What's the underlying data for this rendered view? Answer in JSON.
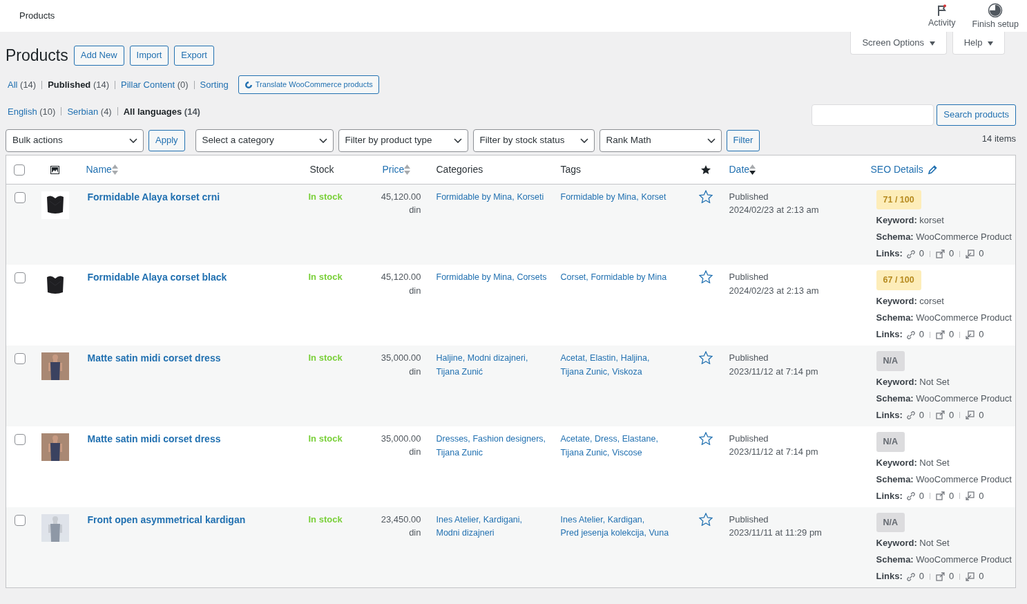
{
  "top_bar": {
    "title": "Products",
    "actions": [
      {
        "kind": "activity",
        "label": "Activity"
      },
      {
        "kind": "setup",
        "label": "Finish setup"
      }
    ]
  },
  "screen_tabs": [
    "Screen Options",
    "Help"
  ],
  "heading": {
    "title": "Products",
    "buttons": [
      "Add New",
      "Import",
      "Export"
    ]
  },
  "views": [
    {
      "label": "All",
      "count": "(14)",
      "selected": false
    },
    {
      "label": "Published",
      "count": "(14)",
      "selected": true
    },
    {
      "label": "Pillar Content",
      "count": "(0)",
      "selected": false
    },
    {
      "label": "Sorting",
      "selected": false
    }
  ],
  "translate_button": "Translate WooCommerce products",
  "languages": [
    {
      "label": "English",
      "count": "(10)",
      "selected": false
    },
    {
      "label": "Serbian",
      "count": "(4)",
      "selected": false
    },
    {
      "label": "All languages",
      "count": "(14)",
      "selected": true
    }
  ],
  "search": {
    "button": "Search products"
  },
  "filters": {
    "bulk": "Bulk actions",
    "apply": "Apply",
    "selects": [
      "Select a category",
      "Filter by product type",
      "Filter by stock status",
      "Rank Math"
    ],
    "filter": "Filter",
    "count": "14 items"
  },
  "columns": [
    {
      "kind": "check",
      "checked": false
    },
    {
      "kind": "thumb"
    },
    {
      "kind": "text",
      "label": "Name",
      "sortable": true,
      "sorted": false
    },
    {
      "kind": "text",
      "label": "Stock"
    },
    {
      "kind": "text",
      "label": "Price",
      "sortable": true,
      "sorted": false
    },
    {
      "kind": "text",
      "label": "Categories"
    },
    {
      "kind": "text",
      "label": "Tags"
    },
    {
      "kind": "featured"
    },
    {
      "kind": "text",
      "label": "Date",
      "sortable": true,
      "sorted": true
    },
    {
      "kind": "edit",
      "label": "SEO Details"
    }
  ],
  "rows": [
    {
      "checked": false,
      "image": {
        "kind": "picture"
      },
      "name": "Formidable Alaya korset crni",
      "stock": "In stock",
      "price": "45,120.00 din",
      "categories": [
        "Formidable by Mina,",
        "Korseti"
      ],
      "tags": [
        "Formidable by Mina,",
        "Korset"
      ],
      "featured": false,
      "status": "Published",
      "date": "2024/02/23 at 2:13 am",
      "seo": {
        "score": "71 / 100",
        "rated": true,
        "keyword": "**Keyword:** korset",
        "schema": "**Schema:** WooCommerce Product",
        "links_label": "Links:",
        "links": [
          "0",
          "0",
          "0"
        ]
      }
    },
    {
      "checked": false,
      "image": {
        "kind": "picture"
      },
      "name": "Formidable Alaya corset black",
      "stock": "In stock",
      "price": "45,120.00 din",
      "categories": [
        "Formidable by Mina,",
        "Corsets"
      ],
      "tags": [
        "Corset,",
        "Formidable by Mina"
      ],
      "featured": false,
      "status": "Published",
      "date": "2024/02/23 at 2:13 am",
      "seo": {
        "score": "67 / 100",
        "rated": true,
        "keyword": "**Keyword:** corset",
        "schema": "**Schema:** WooCommerce Product",
        "links_label": "Links:",
        "links": [
          "0",
          "0",
          "0"
        ]
      }
    },
    {
      "checked": false,
      "image": {
        "kind": "picture"
      },
      "name": "Matte satin midi corset dress",
      "stock": "In stock",
      "price": "35,000.00 din",
      "categories": [
        "Haljine,",
        "Modni dizajneri,",
        "Tijana Zunić"
      ],
      "tags": [
        "Acetat,",
        "Elastin,",
        "Haljina,",
        "Tijana Zunic,",
        "Viskoza"
      ],
      "featured": false,
      "status": "Published",
      "date": "2023/11/12 at 7:14 pm",
      "seo": {
        "score": "N/A",
        "rated": false,
        "keyword": "**Keyword:** Not Set",
        "schema": "**Schema:** WooCommerce Product",
        "links_label": "Links:",
        "links": [
          "0",
          "0",
          "0"
        ]
      }
    },
    {
      "checked": false,
      "image": {
        "kind": "picture"
      },
      "name": "Matte satin midi corset dress",
      "stock": "In stock",
      "price": "35,000.00 din",
      "categories": [
        "Dresses,",
        "Fashion designers,",
        "Tijana Zunic"
      ],
      "tags": [
        "Acetate,",
        "Dress,",
        "Elastane,",
        "Tijana Zunic,",
        "Viscose"
      ],
      "featured": false,
      "status": "Published",
      "date": "2023/11/12 at 7:14 pm",
      "seo": {
        "score": "N/A",
        "rated": false,
        "keyword": "**Keyword:** Not Set",
        "schema": "**Schema:** WooCommerce Product",
        "links_label": "Links:",
        "links": [
          "0",
          "0",
          "0"
        ]
      }
    },
    {
      "checked": false,
      "image": {
        "kind": "picture"
      },
      "name": "Front open asymmetrical kardigan",
      "stock": "In stock",
      "price": "23,450.00 din",
      "categories": [
        "Ines Atelier,",
        "Kardigani,",
        "Modni dizajneri"
      ],
      "tags": [
        "Ines Atelier,",
        "Kardigan,",
        "Pred jesenja kolekcija,",
        "Vuna"
      ],
      "featured": false,
      "status": "Published",
      "date": "2023/11/11 at 11:29 pm",
      "seo": {
        "score": "N/A",
        "rated": false,
        "keyword": "**Keyword:** Not Set",
        "schema": "**Schema:** WooCommerce Product",
        "links_label": "Links:",
        "links": [
          "0",
          "0",
          "0"
        ]
      }
    }
  ]
}
